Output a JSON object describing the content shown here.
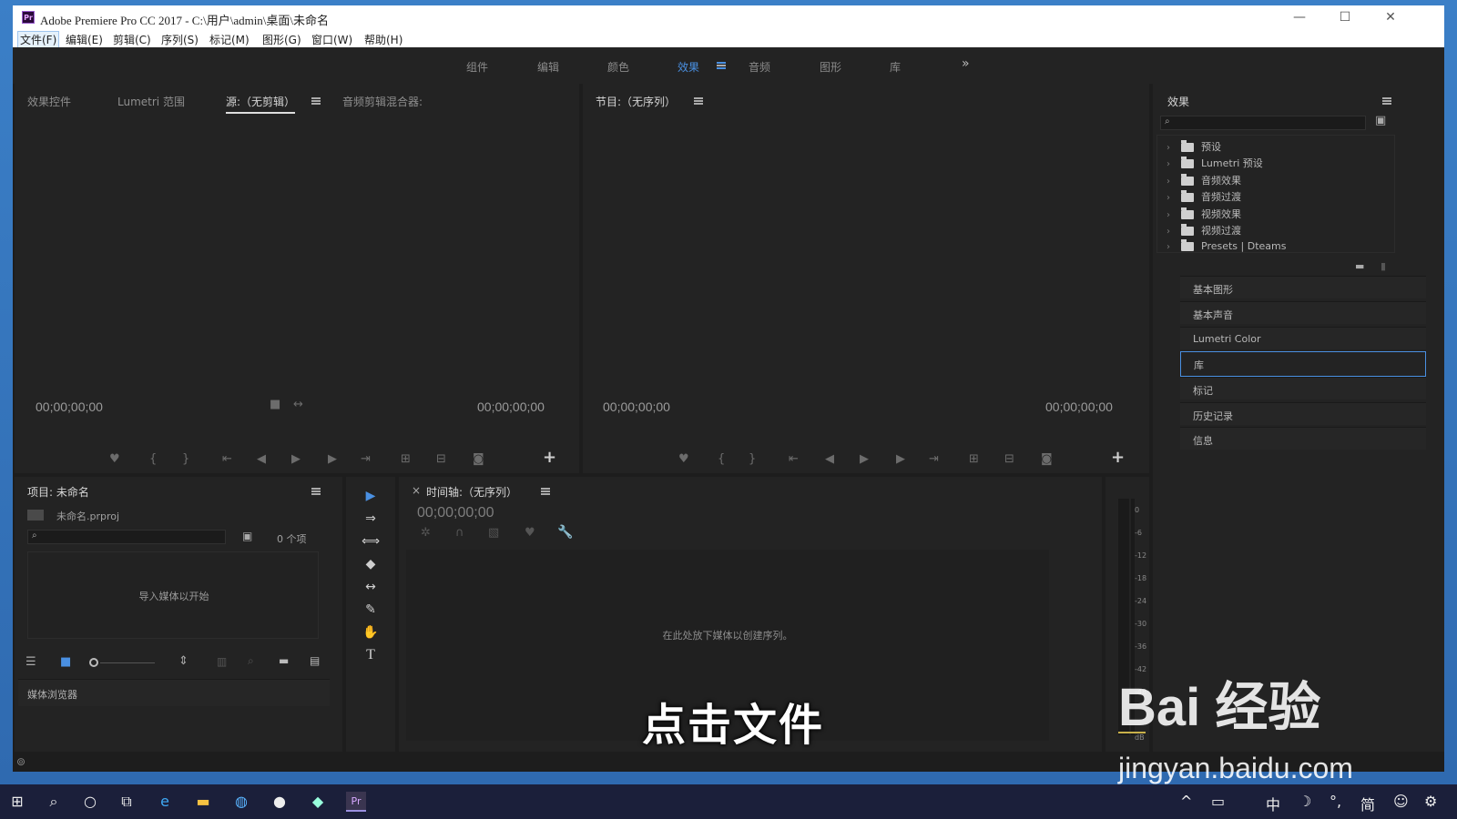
{
  "window": {
    "logo": "Pr",
    "title": "Adobe Premiere Pro CC 2017 - C:\\用户\\admin\\桌面\\未命名",
    "minimize": "—",
    "maximize": "☐",
    "close": "✕"
  },
  "menu": [
    "文件(F)",
    "编辑(E)",
    "剪辑(C)",
    "序列(S)",
    "标记(M)",
    "图形(G)",
    "窗口(W)",
    "帮助(H)"
  ],
  "workspaces": {
    "items": [
      "组件",
      "编辑",
      "颜色",
      "效果",
      "音频",
      "图形",
      "库"
    ],
    "active": "效果",
    "more": "»"
  },
  "source_panel": {
    "tabs": [
      "效果控件",
      "Lumetri 范围",
      "源:（无剪辑）",
      "音频剪辑混合器:"
    ],
    "active_tab": "源:（无剪辑）",
    "timecode_left": "00;00;00;00",
    "timecode_right": "00;00;00;00"
  },
  "program_panel": {
    "title": "节目:（无序列）",
    "timecode_left": "00;00;00;00",
    "timecode_right": "00;00;00;00"
  },
  "effects_panel": {
    "title": "效果",
    "tree": [
      "预设",
      "Lumetri 预设",
      "音频效果",
      "音频过渡",
      "视频效果",
      "视频过渡",
      "Presets | Dteams"
    ],
    "sections": [
      "基本图形",
      "基本声音",
      "Lumetri Color",
      "库",
      "标记",
      "历史记录",
      "信息"
    ],
    "selected_section": "库"
  },
  "project_panel": {
    "title": "项目: 未命名",
    "file": "未命名.prproj",
    "item_count": "0 个项",
    "empty_text": "导入媒体以开始",
    "media_browser": "媒体浏览器"
  },
  "timeline_panel": {
    "close": "×",
    "title": "时间轴:（无序列）",
    "timecode": "00;00;00;00",
    "drop_text": "在此处放下媒体以创建序列。"
  },
  "audio_meter": {
    "scale": [
      "0",
      "-6",
      "-12",
      "-18",
      "-24",
      "-30",
      "-36",
      "-42",
      "-48",
      "dB"
    ]
  },
  "caption": "点击文件",
  "watermark": {
    "logo": "Bai 经验",
    "url": "jingyan.baidu.com"
  },
  "taskbar": {
    "right": [
      "^",
      "中",
      "简"
    ]
  }
}
